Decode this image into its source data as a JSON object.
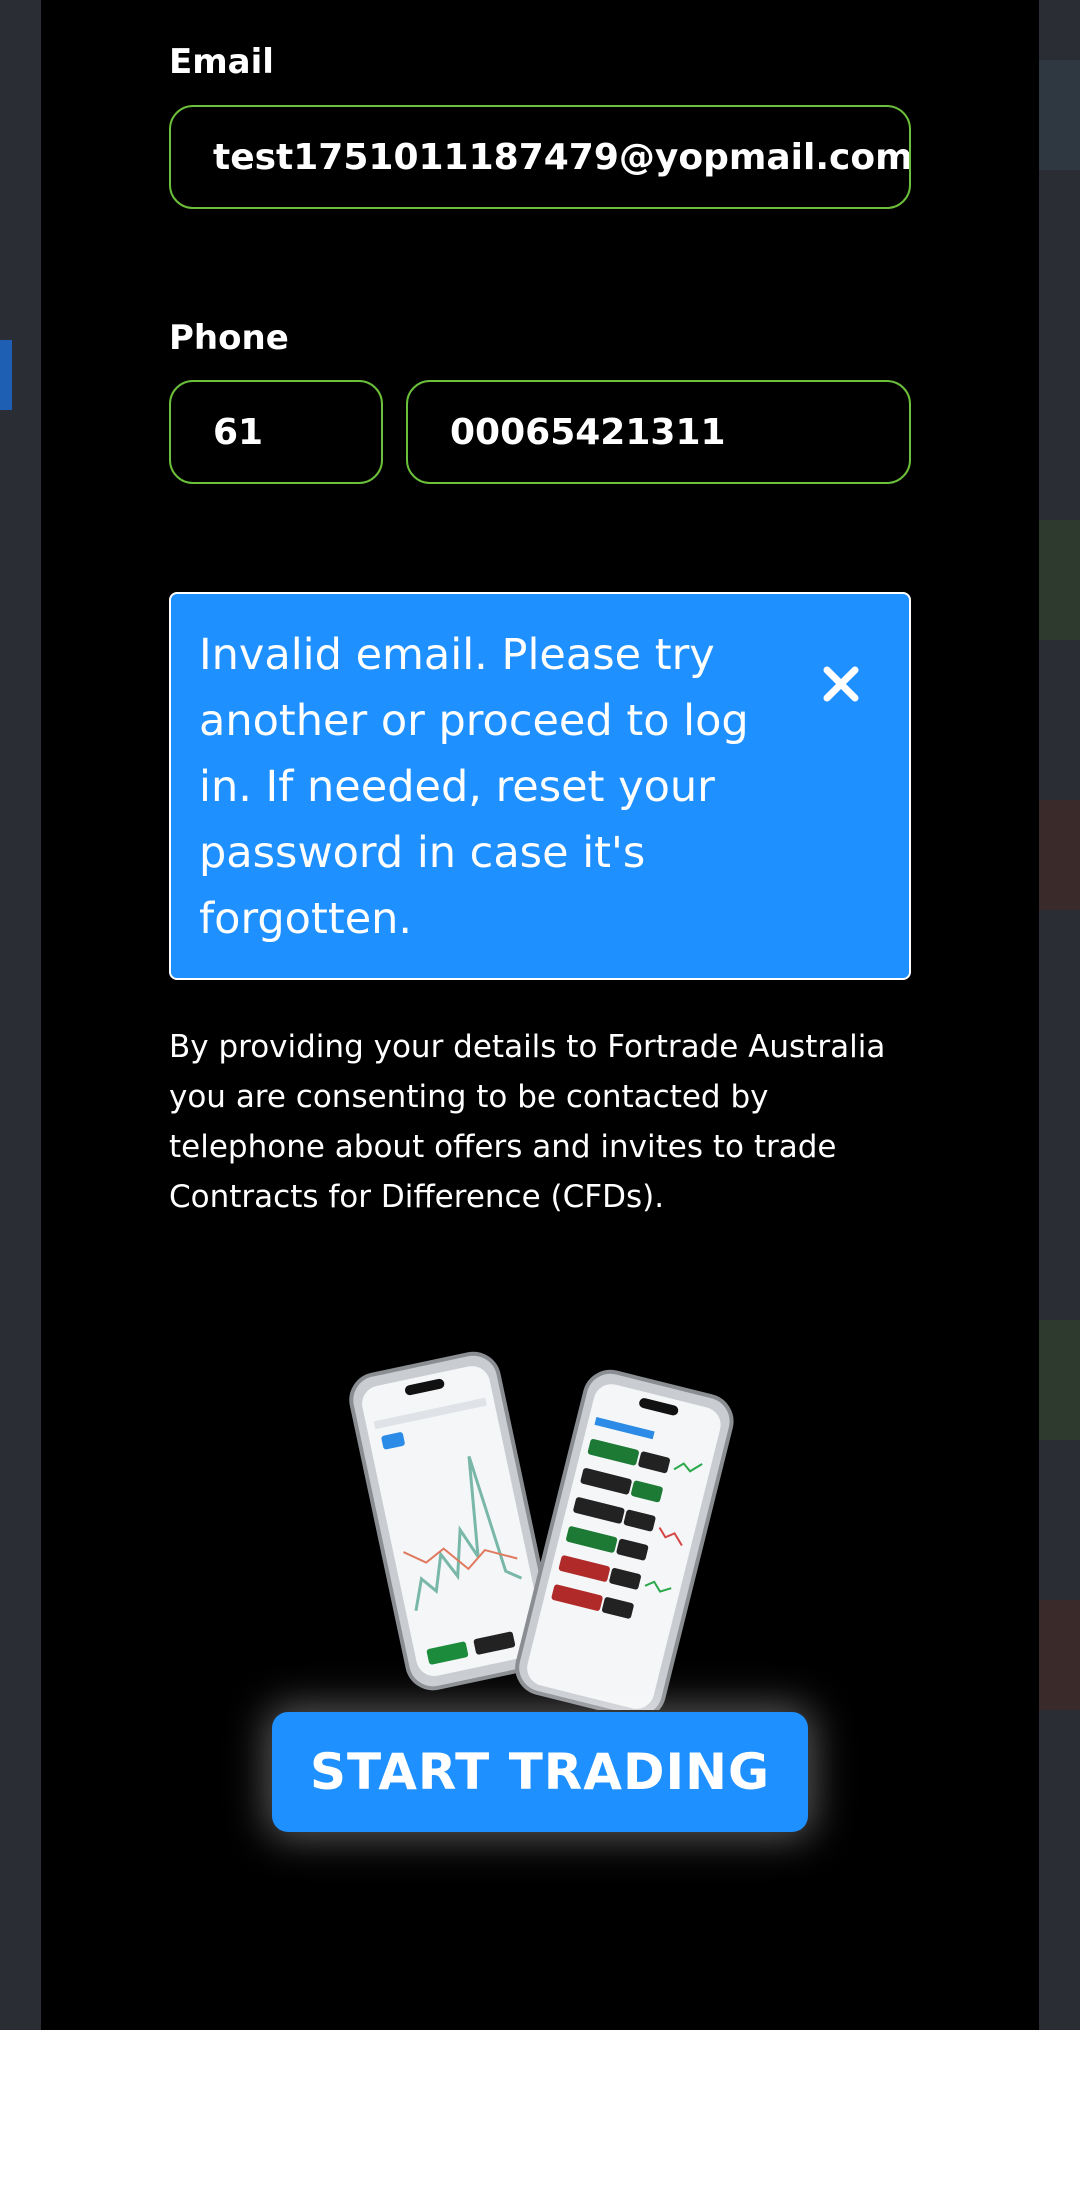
{
  "form": {
    "email_label": "Email",
    "email_value": "test1751011187479@yopmail.com",
    "phone_label": "Phone",
    "phone_code": "61",
    "phone_number": "00065421311"
  },
  "error": {
    "message": "Invalid email. Please try another or proceed to log in. If needed, reset your password in case it's forgotten.",
    "close_icon": "close-icon"
  },
  "consent": {
    "text": "By providing your details to Fortrade Australia you are consenting to be contacted by telephone about offers and invites to trade Contracts for Difference (CFDs)."
  },
  "cta": {
    "label": "START TRADING"
  },
  "colors": {
    "accent": "#1e90ff",
    "input_border": "#6cbf3a",
    "modal_bg": "#000000",
    "backdrop": "#2a2d33"
  }
}
